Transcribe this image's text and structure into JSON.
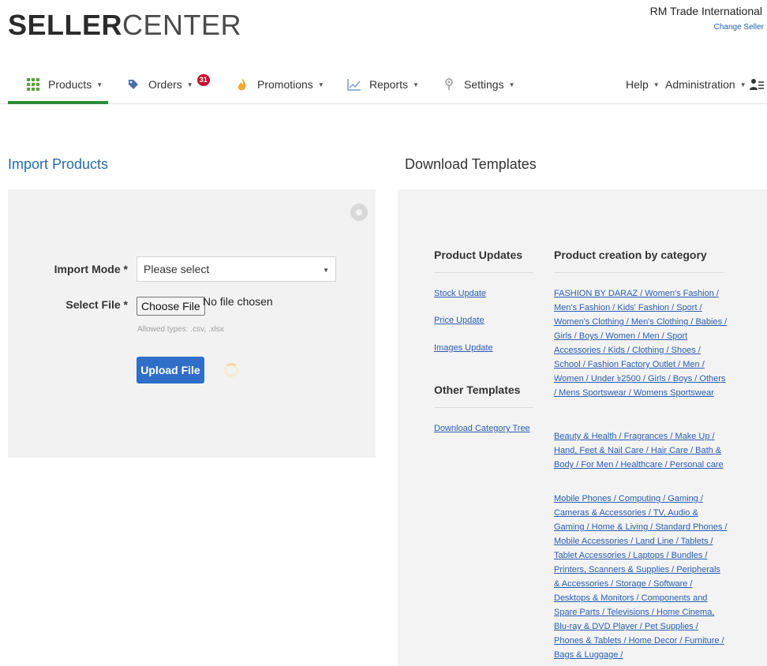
{
  "header": {
    "logo_bold": "SELLER",
    "logo_light": "CENTER",
    "seller_name": "RM Trade International",
    "change_seller": "Change Seller"
  },
  "nav": {
    "products": "Products",
    "orders": "Orders",
    "orders_badge": "31",
    "promotions": "Promotions",
    "reports": "Reports",
    "settings": "Settings",
    "help": "Help",
    "administration": "Administration",
    "active_color": "#2e8b3a"
  },
  "import": {
    "title": "Import Products",
    "mode_label": "Import Mode *",
    "mode_value": "Please select",
    "file_label": "Select File *",
    "choose_button": "Choose File",
    "no_file": "No file chosen",
    "allowed": "Allowed types: .csv, .xlsx",
    "upload_button": "Upload File"
  },
  "templates": {
    "title": "Download Templates",
    "product_updates_title": "Product Updates",
    "stock_update": "Stock Update",
    "price_update": "Price Update",
    "images_update": "Images Update",
    "other_templates_title": "Other Templates",
    "download_category_tree": "Download Category Tree",
    "creation_title": "Product creation by category",
    "categories": [
      "FASHION BY DARAZ / Women's Fashion / Men's Fashion / Kids' Fashion / Sport / Women's Clothing / Men's Clothing / Babies / Girls / Boys / Women / Men / Sport Accessories / Kids / Clothing / Shoes / School / Fashion Factory Outlet / Men / Women / Under ৳2500 / Girls / Boys / Others / Mens Sportswear / Womens Sportswear",
      "Beauty & Health / Fragrances / Make Up / Hand, Feet & Nail Care / Hair Care / Bath & Body / For Men / Healthcare / Personal care",
      "Mobile Phones / Computing / Gaming / Cameras & Accessories / TV, Audio & Gaming / Home & Living / Standard Phones / Mobile Accessories / Land Line / Tablets / Tablet Accessories / Laptops / Bundles / Printers, Scanners & Supplies / Peripherals & Accessories / Storage / Software / Desktops & Monitors / Components and Spare Parts / Televisions / Home Cinema, Blu-ray & DVD Player / Pet Supplies / Phones & Tablets / Home Decor / Furniture / Bags & Luggage /"
    ]
  }
}
